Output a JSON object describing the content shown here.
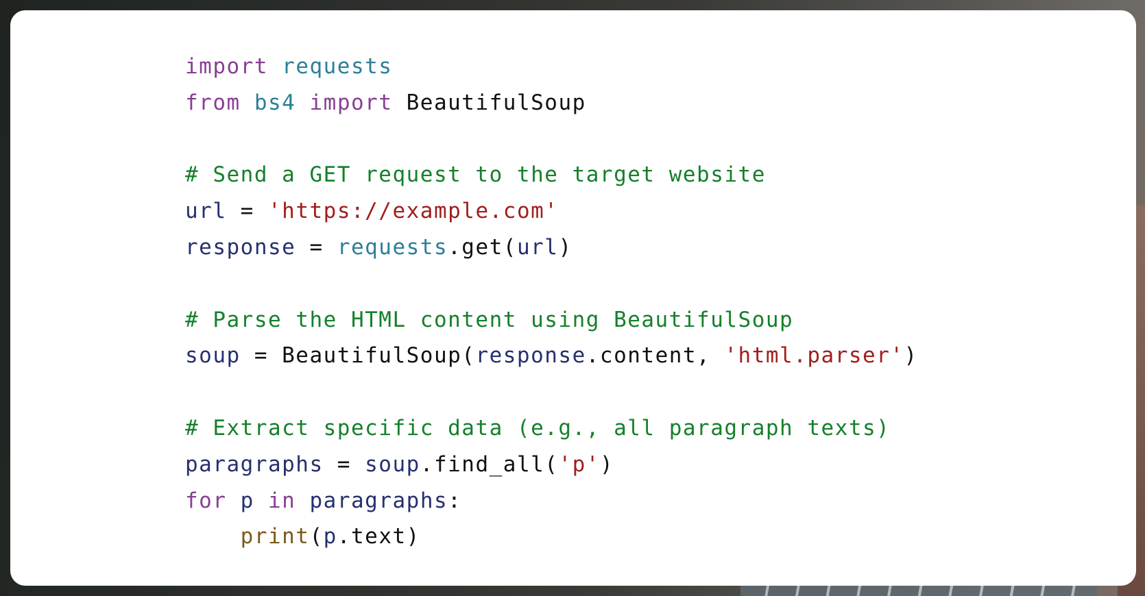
{
  "colors": {
    "keyword": "#8a3e95",
    "module": "#2b7f98",
    "identifier": "#26306f",
    "string": "#a01e1e",
    "comment": "#15802b",
    "builtin": "#7a5a1a",
    "plain": "#111111",
    "card_background": "#ffffff"
  },
  "code": {
    "language": "python",
    "lines": [
      {
        "tokens": [
          {
            "t": "import",
            "c": "kw"
          },
          {
            "t": " ",
            "c": "plain"
          },
          {
            "t": "requests",
            "c": "mod"
          }
        ]
      },
      {
        "tokens": [
          {
            "t": "from",
            "c": "kw"
          },
          {
            "t": " ",
            "c": "plain"
          },
          {
            "t": "bs4",
            "c": "mod"
          },
          {
            "t": " ",
            "c": "plain"
          },
          {
            "t": "import",
            "c": "kw"
          },
          {
            "t": " BeautifulSoup",
            "c": "plain"
          }
        ]
      },
      {
        "tokens": []
      },
      {
        "tokens": [
          {
            "t": "# Send a GET request to the target website",
            "c": "cm"
          }
        ]
      },
      {
        "tokens": [
          {
            "t": "url",
            "c": "id"
          },
          {
            "t": " = ",
            "c": "plain"
          },
          {
            "t": "'https://example.com'",
            "c": "str"
          }
        ]
      },
      {
        "tokens": [
          {
            "t": "response",
            "c": "id"
          },
          {
            "t": " = ",
            "c": "plain"
          },
          {
            "t": "requests",
            "c": "mod"
          },
          {
            "t": ".get(",
            "c": "plain"
          },
          {
            "t": "url",
            "c": "id"
          },
          {
            "t": ")",
            "c": "plain"
          }
        ]
      },
      {
        "tokens": []
      },
      {
        "tokens": [
          {
            "t": "# Parse the HTML content using BeautifulSoup",
            "c": "cm"
          }
        ]
      },
      {
        "tokens": [
          {
            "t": "soup",
            "c": "id"
          },
          {
            "t": " = BeautifulSoup(",
            "c": "plain"
          },
          {
            "t": "response",
            "c": "id"
          },
          {
            "t": ".content, ",
            "c": "plain"
          },
          {
            "t": "'html.parser'",
            "c": "str"
          },
          {
            "t": ")",
            "c": "plain"
          }
        ]
      },
      {
        "tokens": []
      },
      {
        "tokens": [
          {
            "t": "# Extract specific data (e.g., all paragraph texts)",
            "c": "cm"
          }
        ]
      },
      {
        "tokens": [
          {
            "t": "paragraphs",
            "c": "id"
          },
          {
            "t": " = ",
            "c": "plain"
          },
          {
            "t": "soup",
            "c": "id"
          },
          {
            "t": ".find_all(",
            "c": "plain"
          },
          {
            "t": "'p'",
            "c": "str"
          },
          {
            "t": ")",
            "c": "plain"
          }
        ]
      },
      {
        "tokens": [
          {
            "t": "for",
            "c": "kw"
          },
          {
            "t": " ",
            "c": "plain"
          },
          {
            "t": "p",
            "c": "id"
          },
          {
            "t": " ",
            "c": "plain"
          },
          {
            "t": "in",
            "c": "kw"
          },
          {
            "t": " ",
            "c": "plain"
          },
          {
            "t": "paragraphs",
            "c": "id"
          },
          {
            "t": ":",
            "c": "plain"
          }
        ]
      },
      {
        "tokens": [
          {
            "t": "    ",
            "c": "plain"
          },
          {
            "t": "print",
            "c": "fn"
          },
          {
            "t": "(",
            "c": "plain"
          },
          {
            "t": "p",
            "c": "id"
          },
          {
            "t": ".text)",
            "c": "plain"
          }
        ]
      }
    ]
  }
}
